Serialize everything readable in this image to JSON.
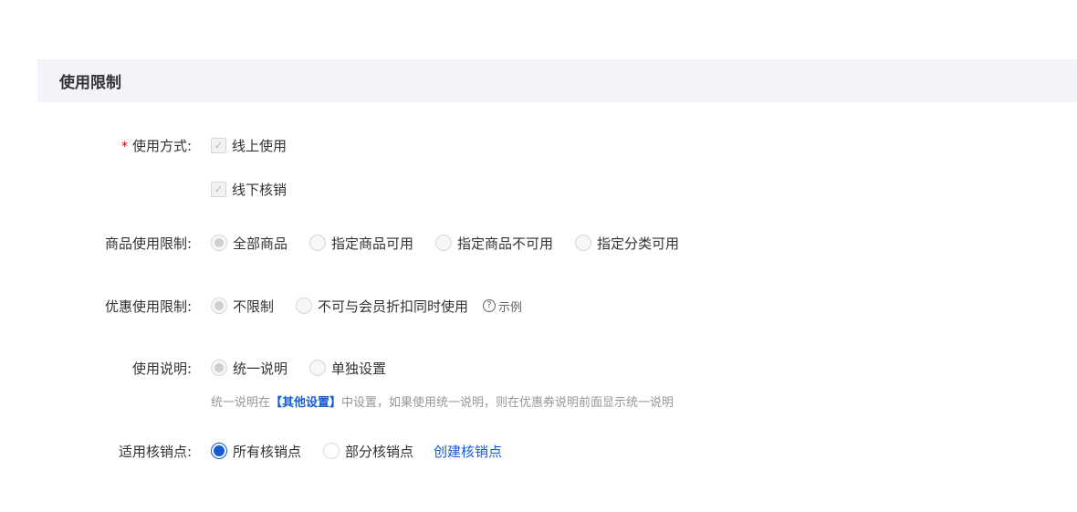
{
  "section": {
    "title": "使用限制"
  },
  "usage_method": {
    "required_mark": "*",
    "label": "使用方式:",
    "options": [
      {
        "label": "线上使用",
        "checked": true,
        "disabled": true
      },
      {
        "label": "线下核销",
        "checked": true,
        "disabled": true
      }
    ]
  },
  "goods_limit": {
    "label": "商品使用限制:",
    "options": [
      "全部商品",
      "指定商品可用",
      "指定商品不可用",
      "指定分类可用"
    ],
    "selected": "全部商品"
  },
  "discount_limit": {
    "label": "优惠使用限制:",
    "options": [
      "不限制",
      "不可与会员折扣同时使用"
    ],
    "selected": "不限制",
    "example_icon": "question-circle-icon",
    "example_label": "示例"
  },
  "usage_desc": {
    "label": "使用说明:",
    "options": [
      "统一说明",
      "单独设置"
    ],
    "selected": "统一说明",
    "help_prefix": "统一说明在",
    "help_highlight": "【其他设置】",
    "help_suffix": "中设置，如果使用统一说明，则在优惠券说明前面显示统一说明"
  },
  "verify_points": {
    "label": "适用核销点:",
    "options": [
      "所有核销点",
      "部分核销点"
    ],
    "selected": "所有核销点",
    "link_label": "创建核销点"
  },
  "colors": {
    "primary": "#155bd4",
    "required": "#d40000",
    "header_bg": "#f2f4fa"
  }
}
